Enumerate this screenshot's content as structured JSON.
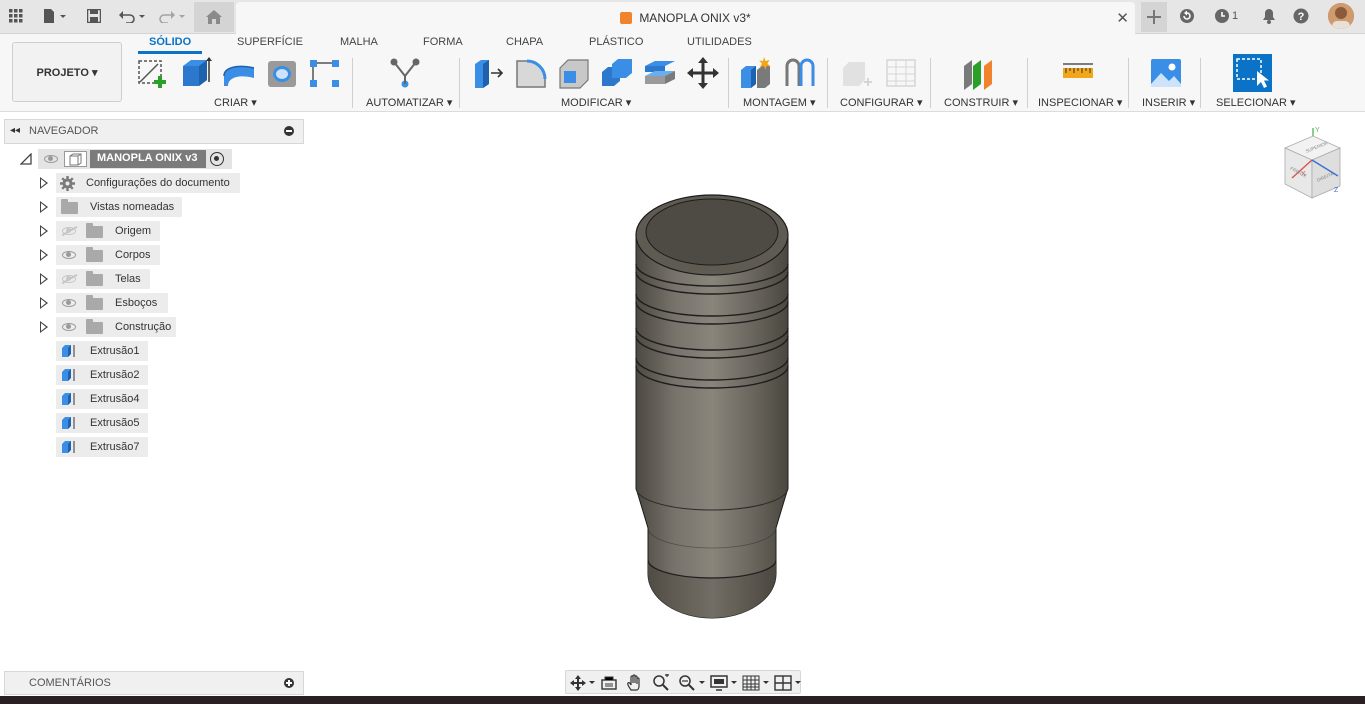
{
  "window": {
    "document_title": "MANOPLA ONIX v3*",
    "notification_count": "1"
  },
  "ribbon": {
    "project_button": "PROJETO ▾",
    "tabs": [
      "SÓLIDO",
      "SUPERFÍCIE",
      "MALHA",
      "FORMA",
      "CHAPA",
      "PLÁSTICO",
      "UTILIDADES"
    ],
    "active_tab": "SÓLIDO",
    "groups": {
      "criar": "CRIAR ▾",
      "automatizar": "AUTOMATIZAR ▾",
      "modificar": "MODIFICAR ▾",
      "montagem": "MONTAGEM ▾",
      "configurar": "CONFIGURAR ▾",
      "construir": "CONSTRUIR ▾",
      "inspecionar": "INSPECIONAR ▾",
      "inserir": "INSERIR ▾",
      "selecionar": "SELECIONAR ▾"
    }
  },
  "navigator": {
    "title": "NAVEGADOR",
    "root": "MANOPLA ONIX v3",
    "folders": [
      {
        "label": "Configurações do documento",
        "icon": "gear-icon",
        "visible": null
      },
      {
        "label": "Vistas nomeadas",
        "icon": "folder-icon",
        "visible": null
      },
      {
        "label": "Origem",
        "icon": "folder-icon",
        "visible": false
      },
      {
        "label": "Corpos",
        "icon": "folder-icon",
        "visible": true
      },
      {
        "label": "Telas",
        "icon": "folder-icon",
        "visible": false
      },
      {
        "label": "Esboços",
        "icon": "folder-icon",
        "visible": true
      },
      {
        "label": "Construção",
        "icon": "folder-icon",
        "visible": true
      }
    ],
    "features": [
      "Extrusão1",
      "Extrusão2",
      "Extrusão4",
      "Extrusão5",
      "Extrusão7"
    ]
  },
  "viewcube": {
    "top": "SUPERIOR",
    "front": "FRENTE",
    "right": "DIREITA",
    "axis_y": "Y",
    "axis_x": "X",
    "axis_z": "Z"
  },
  "comments": {
    "title": "COMENTÁRIOS"
  },
  "colors": {
    "accent": "#0a72c7",
    "model": "#6b665c",
    "doc_icon": "#f0832c"
  }
}
